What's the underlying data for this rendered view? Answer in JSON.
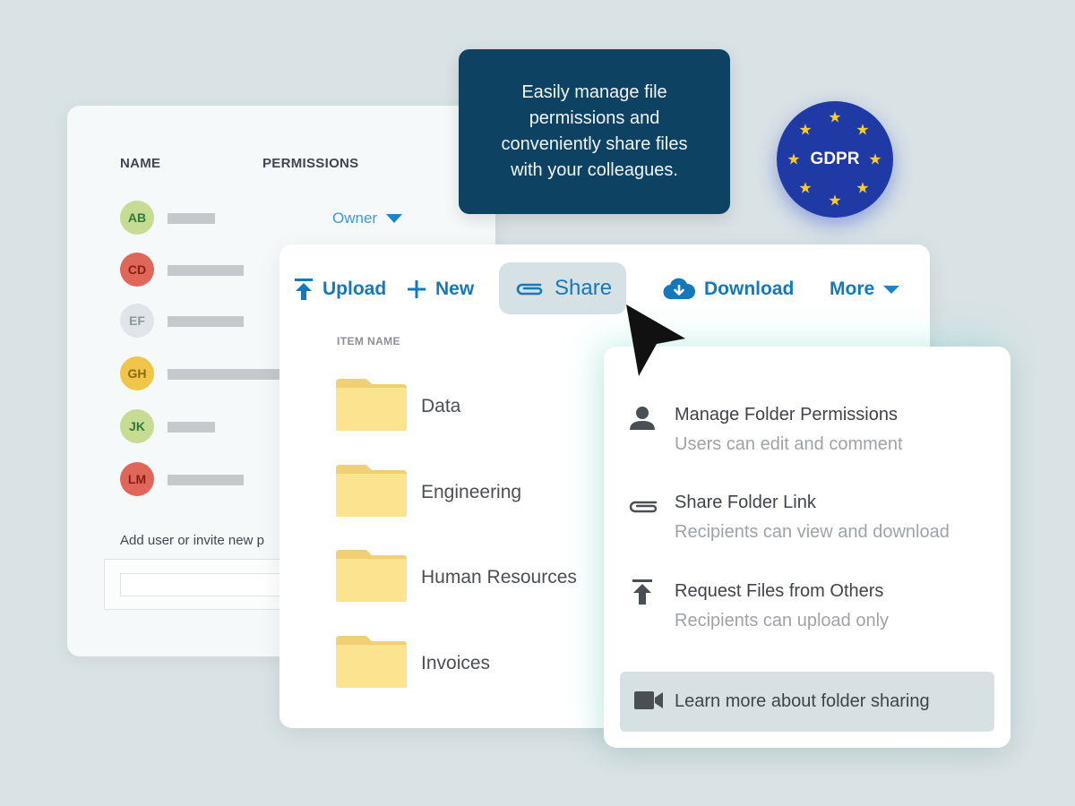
{
  "permissions_panel": {
    "col_name": "NAME",
    "col_permissions": "PERMISSIONS",
    "owner_label": "Owner",
    "users": [
      {
        "initials": "AB",
        "bg": "#c6dc93",
        "fg": "#2f7a3a"
      },
      {
        "initials": "CD",
        "bg": "#e0665a",
        "fg": "#8a1e16"
      },
      {
        "initials": "EF",
        "bg": "#dfe5e8",
        "fg": "#8c969d"
      },
      {
        "initials": "GH",
        "bg": "#f0c54a",
        "fg": "#8a6a10"
      },
      {
        "initials": "JK",
        "bg": "#c6dc93",
        "fg": "#2f7a3a"
      },
      {
        "initials": "LM",
        "bg": "#e0665a",
        "fg": "#8a1e16"
      }
    ],
    "add_user_label": "Add user or invite new p"
  },
  "tooltip": {
    "text": "Easily manage file permissions and conveniently share files with your colleagues."
  },
  "gdpr_badge": {
    "text": "GDPR",
    "bg": "#1f3aa5",
    "star_color": "#f7cd2a"
  },
  "toolbar": {
    "upload": "Upload",
    "new": "New",
    "share": "Share",
    "download": "Download",
    "more": "More",
    "accent": "#1478bd"
  },
  "file_list": {
    "column_header": "ITEM NAME",
    "folders": [
      {
        "name": "Data",
        "icon": "folder-icon"
      },
      {
        "name": "Engineering",
        "icon": "folder-icon"
      },
      {
        "name": "Human Resources",
        "icon": "folder-icon"
      },
      {
        "name": "Invoices",
        "icon": "folder-icon"
      }
    ]
  },
  "share_menu": {
    "items": [
      {
        "title": "Manage Folder Permissions",
        "subtitle": "Users can edit and comment",
        "icon": "user-icon"
      },
      {
        "title": "Share Folder Link",
        "subtitle": "Recipients can view and download",
        "icon": "paperclip-icon"
      },
      {
        "title": "Request Files from Others",
        "subtitle": "Recipients can upload only",
        "icon": "upload-icon"
      }
    ],
    "learn_more": "Learn more about folder sharing",
    "learn_more_icon": "video-camera-icon"
  }
}
